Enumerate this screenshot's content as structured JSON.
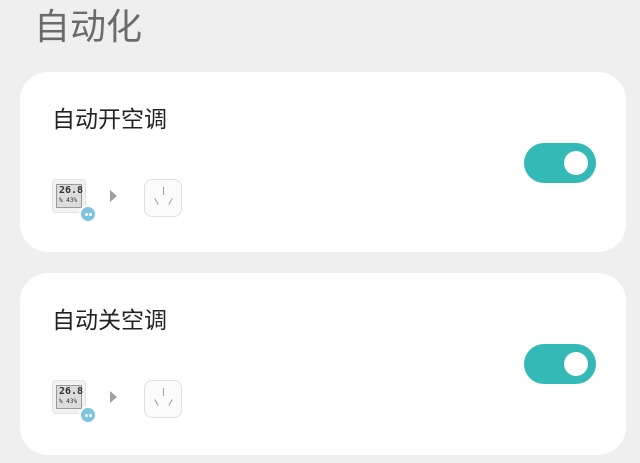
{
  "page": {
    "title": "自动化"
  },
  "automations": [
    {
      "name": "自动开空调",
      "enabled": true,
      "trigger_device": {
        "icon": "thermometer-hygrometer-icon",
        "temp_text": "26.8",
        "humidity_text": "% 43%"
      },
      "action_device": {
        "icon": "smart-plug-icon"
      }
    },
    {
      "name": "自动关空调",
      "enabled": true,
      "trigger_device": {
        "icon": "thermometer-hygrometer-icon",
        "temp_text": "26.8",
        "humidity_text": "% 43%"
      },
      "action_device": {
        "icon": "smart-plug-icon"
      }
    }
  ],
  "colors": {
    "toggle_on": "#33b9b6",
    "background": "#efefef",
    "card": "#ffffff"
  }
}
